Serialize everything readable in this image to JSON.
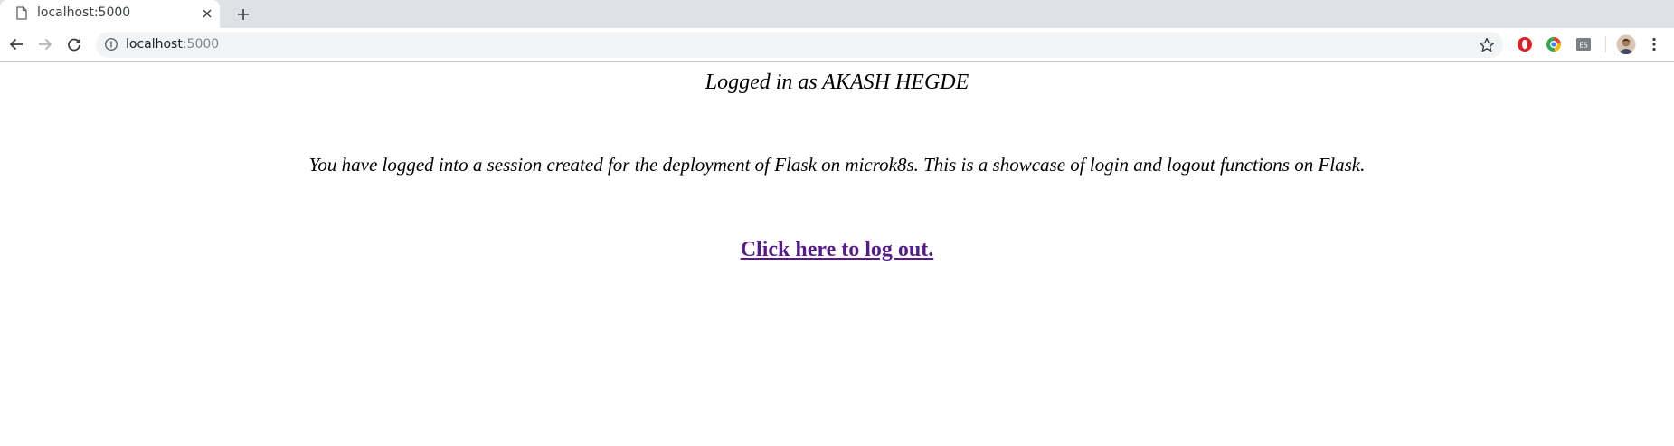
{
  "browser": {
    "tab": {
      "title": "localhost:5000",
      "favicon_icon": "page-icon",
      "close_icon": "close-icon"
    },
    "new_tab_icon": "plus-icon",
    "toolbar": {
      "back_icon": "back-arrow-icon",
      "forward_icon": "forward-arrow-icon",
      "reload_icon": "reload-icon",
      "site_info_icon": "info-icon",
      "url_host": "localhost",
      "url_port": ":5000",
      "bookmark_icon": "star-icon",
      "extensions": [
        "opera-extension-icon",
        "chrome-sync-extension-icon",
        "es-extension-icon"
      ],
      "extension_label": "ES",
      "profile_icon": "avatar",
      "menu_icon": "kebab-menu-icon"
    }
  },
  "page": {
    "logged_in_text": "Logged in as AKASH HEGDE",
    "session_text": "You have logged into a session created for the deployment of Flask on microk8s. This is a showcase of login and logout functions on Flask.",
    "logout_link_text": "Click here to log out.",
    "link_color": "#551a8b"
  }
}
